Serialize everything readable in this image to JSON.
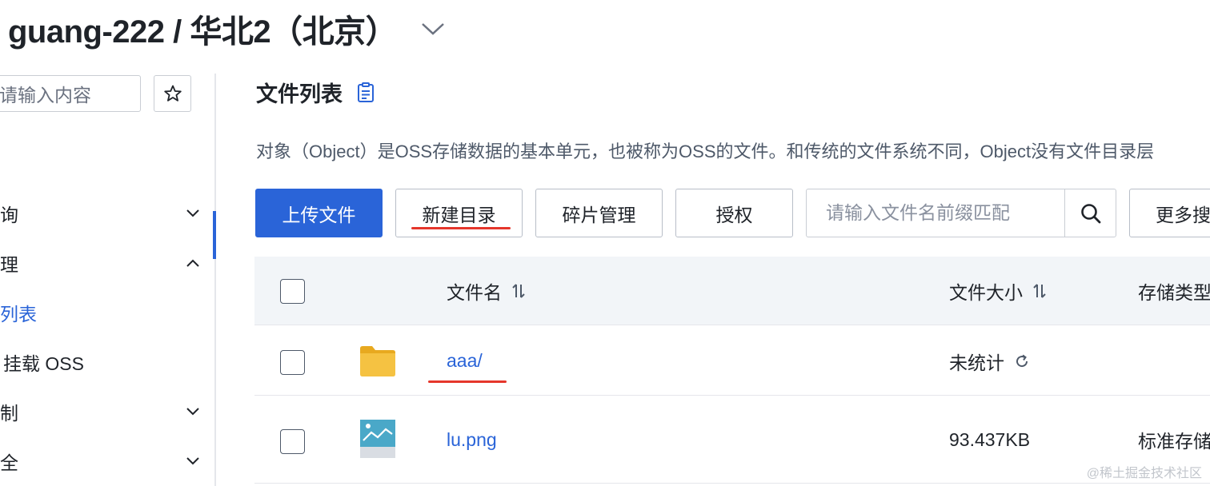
{
  "header": {
    "bucket_title": "guang-222 / 华北2（北京）",
    "dropdown_icon": "chevron-down-icon"
  },
  "sidebar": {
    "search_placeholder": "请输入内容",
    "star_icon": "star-icon",
    "items": [
      {
        "label": "询",
        "arrow": "chevron-down-icon"
      },
      {
        "label": "理",
        "arrow": "chevron-up-icon"
      },
      {
        "label": "列表",
        "active": true
      },
      {
        "label": "挂载 OSS"
      },
      {
        "label": "制",
        "arrow": "chevron-down-icon"
      },
      {
        "label": "全",
        "arrow": "chevron-down-icon"
      }
    ]
  },
  "main": {
    "title": "文件列表",
    "title_icon": "document-icon",
    "description": "对象（Object）是OSS存储数据的基本单元，也被称为OSS的文件。和传统的文件系统不同，Object没有文件目录层",
    "toolbar": {
      "upload_label": "上传文件",
      "new_dir_label": "新建目录",
      "fragment_label": "碎片管理",
      "auth_label": "授权",
      "search_placeholder": "请输入文件名前缀匹配",
      "more_search_label": "更多搜"
    },
    "table": {
      "columns": {
        "name": "文件名",
        "size": "文件大小",
        "storage": "存储类型"
      },
      "rows": [
        {
          "name": "aaa/",
          "type": "folder",
          "size": "未统计",
          "size_icon": "refresh-icon",
          "storage": ""
        },
        {
          "name": "lu.png",
          "type": "image",
          "size": "93.437KB",
          "storage": "标准存储"
        }
      ]
    }
  },
  "watermark": "@稀土掘金技术社区",
  "colors": {
    "primary": "#2a64d8",
    "annotation_red": "#e5362b",
    "folder_yellow": "#f5c242",
    "header_bg": "#f2f5f8"
  }
}
